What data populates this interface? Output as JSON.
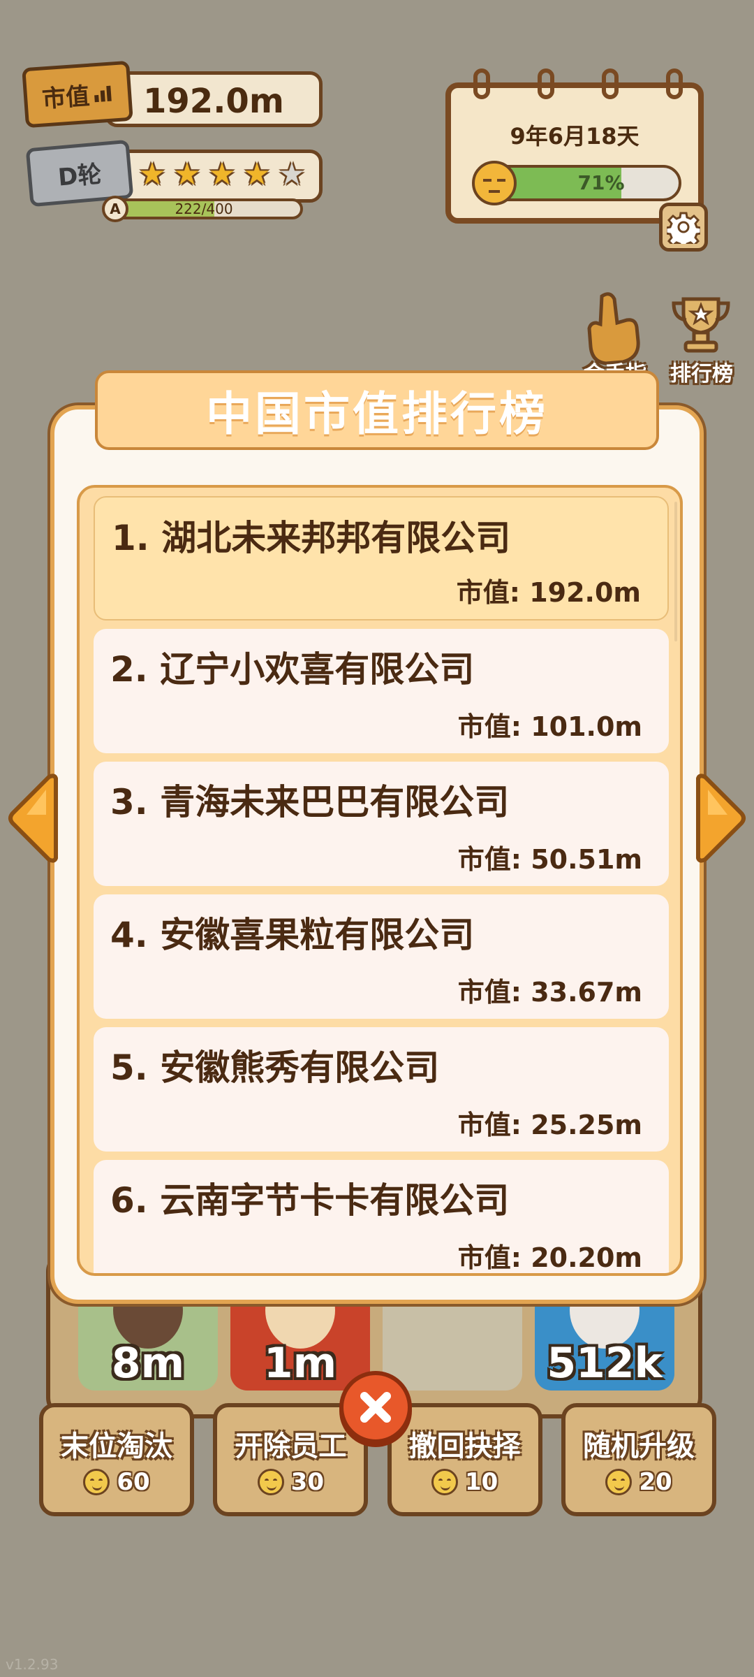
{
  "hud": {
    "market_value_label": "市值",
    "market_value": "192.0m",
    "round_label": "D轮",
    "stars_filled": 4,
    "stars_total": 5,
    "progress_letter": "A",
    "progress_text": "222/400",
    "progress_fraction": 0.555
  },
  "calendar": {
    "date": "9年6月18天",
    "mood_percent_text": "71%",
    "mood_fraction": 0.71
  },
  "side_icons": {
    "finger_label": "金手指",
    "ranking_label": "排行榜"
  },
  "modal": {
    "title": "中国市值排行榜",
    "value_prefix": "市值: ",
    "items": [
      {
        "name": "1. 湖北未来邦邦有限公司",
        "value": "市值: 192.0m"
      },
      {
        "name": "2. 辽宁小欢喜有限公司",
        "value": "市值: 101.0m"
      },
      {
        "name": "3. 青海未来巴巴有限公司",
        "value": "市值: 50.51m"
      },
      {
        "name": "4. 安徽喜果粒有限公司",
        "value": "市值: 33.67m"
      },
      {
        "name": "5. 安徽熊秀有限公司",
        "value": "市值: 25.25m"
      },
      {
        "name": "6. 云南字节卡卡有限公司",
        "value": "市值: 20.20m"
      }
    ]
  },
  "board": {
    "tiles": [
      {
        "value": "8m",
        "color": "#a8c08a"
      },
      {
        "value": "1m",
        "color": "#c9432a"
      },
      {
        "value": "",
        "color": "#c8bfa6"
      },
      {
        "value": "512k",
        "color": "#3a8fc8"
      }
    ]
  },
  "actions": [
    {
      "title": "末位淘汰",
      "cost": "60"
    },
    {
      "title": "开除员工",
      "cost": "30"
    },
    {
      "title": "撤回抉择",
      "cost": "10"
    },
    {
      "title": "随机升级",
      "cost": "20"
    }
  ],
  "version": "v1.2.93"
}
